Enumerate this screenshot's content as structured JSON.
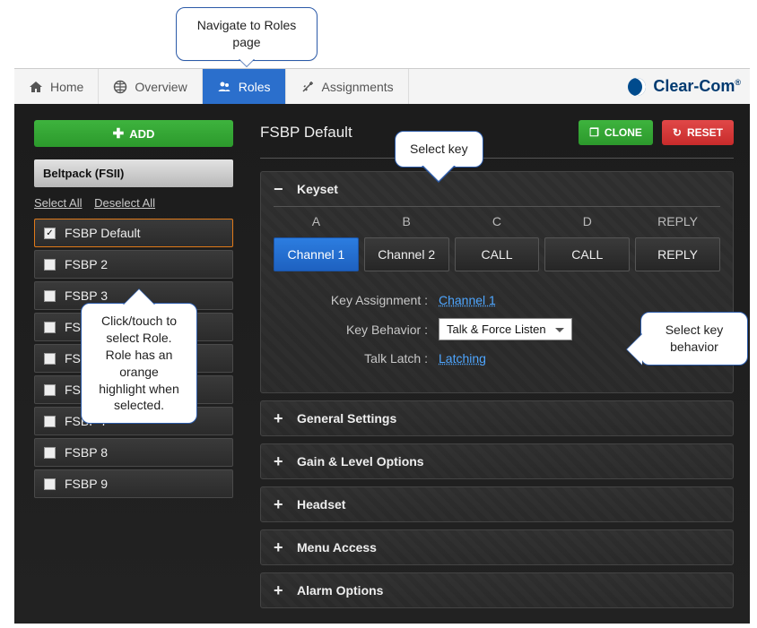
{
  "nav": {
    "items": [
      {
        "label": "Home",
        "icon": "home-icon",
        "active": false
      },
      {
        "label": "Overview",
        "icon": "globe-icon",
        "active": false
      },
      {
        "label": "Roles",
        "icon": "users-icon",
        "active": true
      },
      {
        "label": "Assignments",
        "icon": "wand-icon",
        "active": false
      }
    ],
    "brand": "Clear-Com"
  },
  "sidebar": {
    "add_label": "ADD",
    "panel_title": "Beltpack (FSII)",
    "select_all": "Select All",
    "deselect_all": "Deselect All",
    "roles": [
      {
        "label": "FSBP Default",
        "checked": true,
        "selected": true
      },
      {
        "label": "FSBP 2",
        "checked": false,
        "selected": false
      },
      {
        "label": "FSBP 3",
        "checked": false,
        "selected": false
      },
      {
        "label": "FSBP 4",
        "checked": false,
        "selected": false
      },
      {
        "label": "FSBP 5",
        "checked": false,
        "selected": false
      },
      {
        "label": "FSBP 6",
        "checked": false,
        "selected": false
      },
      {
        "label": "FSBP 7",
        "checked": false,
        "selected": false
      },
      {
        "label": "FSBP 8",
        "checked": false,
        "selected": false
      },
      {
        "label": "FSBP 9",
        "checked": false,
        "selected": false
      }
    ]
  },
  "main": {
    "title": "FSBP Default",
    "clone_label": "CLONE",
    "reset_label": "RESET",
    "keyset": {
      "title": "Keyset",
      "headers": [
        "A",
        "B",
        "C",
        "D",
        "REPLY"
      ],
      "buttons": [
        "Channel 1",
        "Channel 2",
        "CALL",
        "CALL",
        "REPLY"
      ],
      "selected_index": 0,
      "rows": {
        "assignment_label": "Key Assignment :",
        "assignment_value": "Channel 1",
        "behavior_label": "Key Behavior :",
        "behavior_value": "Talk & Force Listen",
        "latch_label": "Talk Latch :",
        "latch_value": "Latching"
      }
    },
    "collapsed_sections": [
      "General Settings",
      "Gain & Level Options",
      "Headset",
      "Menu Access",
      "Alarm Options"
    ]
  },
  "callouts": {
    "nav": "Navigate to Roles page",
    "role": "Click/touch to select Role. Role has an orange highlight when selected.",
    "key": "Select key",
    "behavior": "Select key behavior"
  }
}
